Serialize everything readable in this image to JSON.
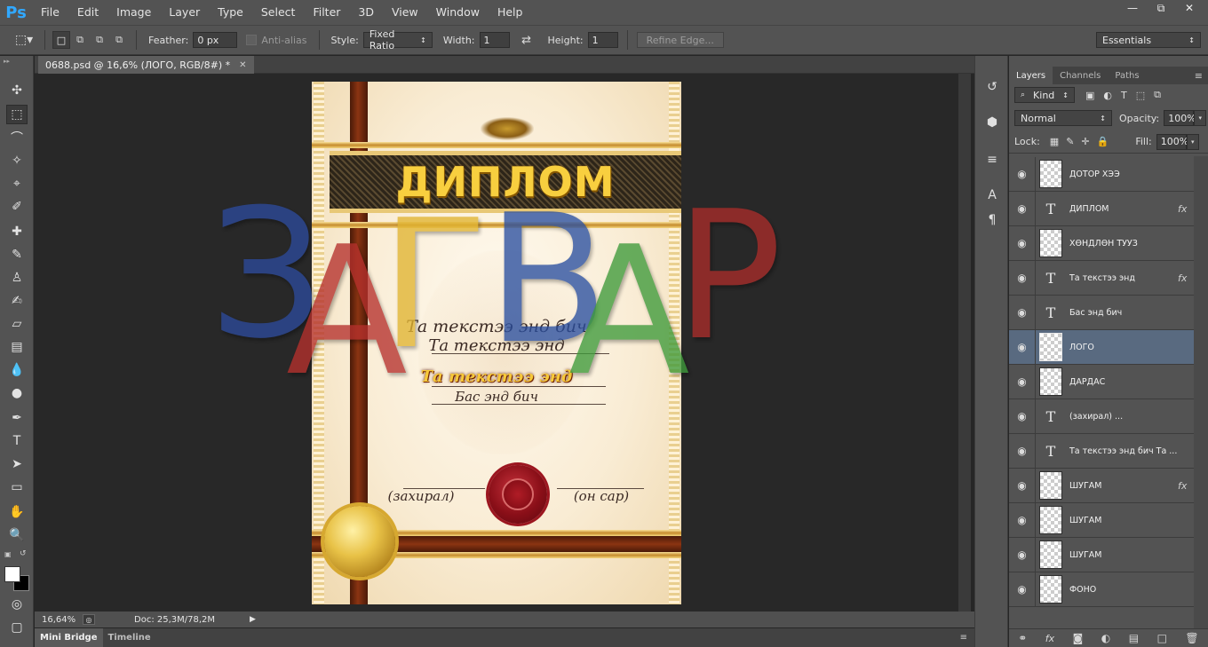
{
  "app": {
    "logo": "Ps",
    "menu": [
      "File",
      "Edit",
      "Image",
      "Layer",
      "Type",
      "Select",
      "Filter",
      "3D",
      "View",
      "Window",
      "Help"
    ],
    "window_controls": [
      "minimize-icon",
      "restore-icon",
      "close-icon"
    ]
  },
  "options": {
    "feather_label": "Feather:",
    "feather_value": "0 px",
    "antialias_label": "Anti-alias",
    "style_label": "Style:",
    "style_value": "Fixed Ratio",
    "width_label": "Width:",
    "width_value": "1",
    "height_label": "Height:",
    "height_value": "1",
    "refine_edge": "Refine Edge...",
    "workspace": "Essentials"
  },
  "document": {
    "tab_title": "0688.psd @ 16,6% (ЛОГО, RGB/8#) *",
    "zoom": "16,64%",
    "doc_size": "Doc: 25,3M/78,2M",
    "banner_title": "ДИПЛОМ",
    "line1": "Та текстээ энд бич",
    "line2": "Та текстээ энд",
    "line3": "Та текстээ энд",
    "line4": "Бас энд бич",
    "left_sign": "(захирал)",
    "right_sign": "(он сар)",
    "watermark": [
      "З",
      "А",
      "Г",
      "В",
      "А",
      "Р"
    ]
  },
  "bottom_tabs": [
    "Mini Bridge",
    "Timeline"
  ],
  "panel": {
    "tabs": [
      "Layers",
      "Channels",
      "Paths"
    ],
    "filter_kind": "Kind",
    "blend_mode": "Normal",
    "opacity_label": "Opacity:",
    "opacity_value": "100%",
    "lock_label": "Lock:",
    "fill_label": "Fill:",
    "fill_value": "100%",
    "layers": [
      {
        "name": "ДОТОР ХЭЭ",
        "kind": "image",
        "fx": false,
        "selected": false
      },
      {
        "name": "ДИПЛОМ",
        "kind": "text",
        "fx": true,
        "selected": false
      },
      {
        "name": "ХӨНДЛӨН ТУУЗ",
        "kind": "image",
        "fx": false,
        "selected": false
      },
      {
        "name": "Та текстээ энд",
        "kind": "text",
        "fx": true,
        "selected": false
      },
      {
        "name": "Бас энд бич",
        "kind": "text",
        "fx": false,
        "selected": false
      },
      {
        "name": "ЛОГО",
        "kind": "image",
        "fx": false,
        "selected": true
      },
      {
        "name": "ДАРДАС",
        "kind": "image",
        "fx": false,
        "selected": false
      },
      {
        "name": "(захирал)         ...",
        "kind": "text",
        "fx": false,
        "selected": false
      },
      {
        "name": "Та текстээ энд бич Та ...",
        "kind": "text",
        "fx": false,
        "selected": false
      },
      {
        "name": "ШУГАМ",
        "kind": "image",
        "fx": true,
        "selected": false
      },
      {
        "name": "ШУГАМ",
        "kind": "image",
        "fx": false,
        "selected": false
      },
      {
        "name": "ШУГАМ",
        "kind": "image",
        "fx": false,
        "selected": false
      },
      {
        "name": "ФОНО",
        "kind": "image",
        "fx": false,
        "selected": false
      }
    ]
  }
}
